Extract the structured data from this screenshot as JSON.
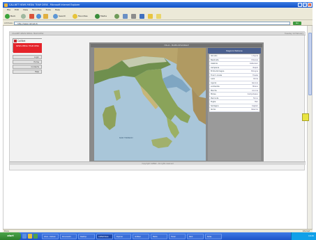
{
  "window": {
    "title": "CALLNET NEWS MEDIA TEAM DESK - Microsoft Internet Explorer",
    "min_glyph": "_",
    "max_glyph": "□",
    "close_glyph": "×"
  },
  "menubar": {
    "items": [
      "File",
      "Edit",
      "View",
      "Favorites",
      "Tools",
      "Help"
    ]
  },
  "toolbar": {
    "back_label": "Back",
    "search_label": "Search",
    "favorites_label": "Favorites",
    "media_label": "Media"
  },
  "address": {
    "label": "Address",
    "value": "http://www.callnet.it/",
    "go_label": "Go"
  },
  "page": {
    "header_left": "CALLNET NEWS MEDIA TEAM DESK",
    "header_right": "Tuesday 14 February",
    "logo_name": "CallNet",
    "logo_subtitle": "NEWS MEDIA TEAM DESK",
    "nav": [
      "Login",
      "Home",
      "Contacts",
      "Help"
    ],
    "content_strip": "ITALIA - MAPPA REGIONALE",
    "panel_title": "Regioni Italiane",
    "panel_rows": [
      {
        "name": "Abruzzo",
        "value": "L'Aquila"
      },
      {
        "name": "Basilicata",
        "value": "Potenza"
      },
      {
        "name": "Calabria",
        "value": "Catanzaro"
      },
      {
        "name": "Campania",
        "value": "Napoli"
      },
      {
        "name": "Emilia Romagna",
        "value": "Bologna"
      },
      {
        "name": "Friuli V. Giulia",
        "value": "Trieste"
      },
      {
        "name": "Lazio",
        "value": "Roma"
      },
      {
        "name": "Liguria",
        "value": "Genova"
      },
      {
        "name": "Lombardia",
        "value": "Milano"
      },
      {
        "name": "Marche",
        "value": "Ancona"
      },
      {
        "name": "Molise",
        "value": "Campobasso"
      },
      {
        "name": "Piemonte",
        "value": "Torino"
      },
      {
        "name": "Puglia",
        "value": "Bari"
      },
      {
        "name": "Sardegna",
        "value": "Cagliari"
      },
      {
        "name": "Sicilia",
        "value": "Palermo"
      }
    ],
    "footer_text": "Copyright CallNet - All rights reserved"
  },
  "map": {
    "sea_label": "MAR TIRRENO"
  },
  "statusbar": {
    "text": "Done",
    "zone": "Internet"
  },
  "taskbar": {
    "start_label": "start",
    "tasks": [
      "Inbox - Outlook",
      "Document1",
      "Desktop",
      "CallNet News",
      "Explorer",
      "Untitled",
      "Media",
      "Folder",
      "Paint",
      "Notes"
    ],
    "active_index": 3,
    "clock": "10:45"
  },
  "colors": {
    "accent_red": "#e5232a",
    "panel_title_bg": "#4a5f8e",
    "taskbar_blue": "#1e54c8"
  }
}
